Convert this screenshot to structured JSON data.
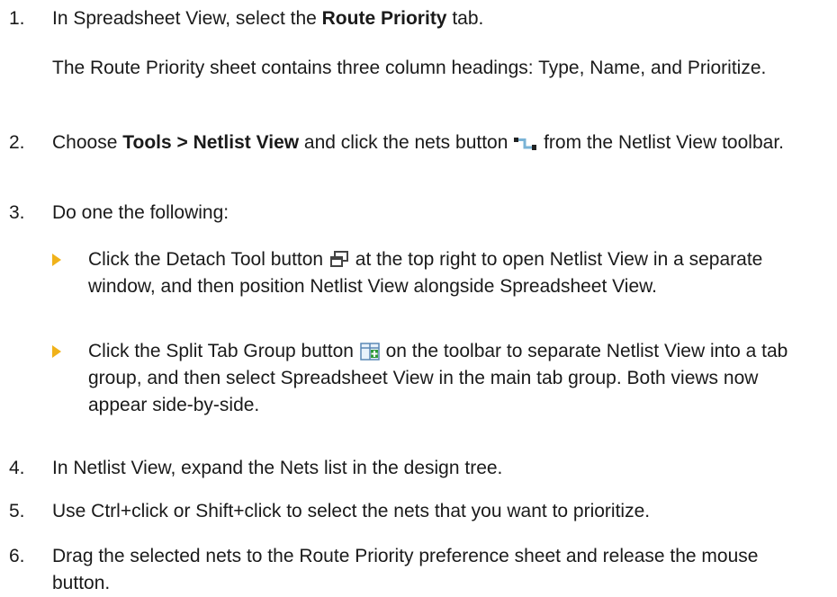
{
  "steps": [
    {
      "num": "1.",
      "pre": "In Spreadsheet View, select the ",
      "bold": "Route Priority",
      "post": " tab."
    },
    {
      "sub": "The Route Priority sheet contains three column headings: Type, Name, and Prioritize."
    },
    {
      "num": "2.",
      "pre": "Choose ",
      "bold": "Tools > Netlist View",
      "mid": " and click the nets button ",
      "post": " from the Netlist View toolbar."
    },
    {
      "num": "3.",
      "text": "Do one the following:"
    },
    {
      "num": "4.",
      "text": "In Netlist View, expand the Nets list in the design tree."
    },
    {
      "num": "5.",
      "text": "Use Ctrl+click or Shift+click to select the nets that you want to prioritize."
    },
    {
      "num": "6.",
      "text": "Drag the selected nets to the Route Priority preference sheet and release the mouse button."
    }
  ],
  "bullets": [
    {
      "pre": "Click the Detach Tool button ",
      "post": " at the top right to open Netlist View in a separate window, and then position Netlist View alongside Spreadsheet View.",
      "icon": "detach-tool-icon"
    },
    {
      "pre": "Click the Split Tab Group button ",
      "post": " on the toolbar to separate Netlist View into a tab group, and then select Spreadsheet View in the main tab group. Both views now appear side-by-side.",
      "icon": "split-tab-group-icon"
    }
  ],
  "colors": {
    "bullet": "#f0b21a",
    "text": "#1a1a1a"
  }
}
